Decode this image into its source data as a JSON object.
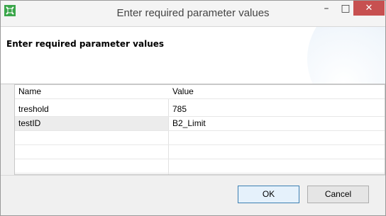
{
  "window": {
    "title": "Enter required parameter values",
    "minimize_glyph": "–",
    "maximize_glyph": "□",
    "close_glyph": "✕",
    "icon": "app-icon"
  },
  "header": {
    "title": "Enter required parameter values"
  },
  "table": {
    "columns": [
      "Name",
      "Value"
    ],
    "rows": [
      {
        "name": "treshold",
        "value": "785"
      },
      {
        "name": "testID",
        "value": "B2_Limit"
      }
    ]
  },
  "buttons": {
    "ok": "OK",
    "cancel": "Cancel"
  },
  "colors": {
    "close_button": "#c75050",
    "icon_green": "#3aa64a"
  }
}
